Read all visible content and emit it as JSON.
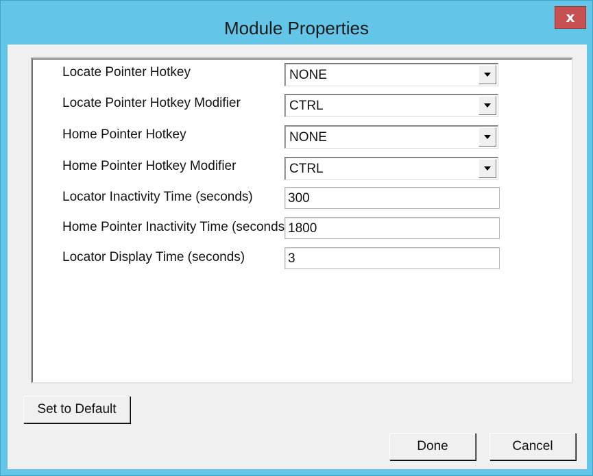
{
  "window": {
    "title": "Module Properties",
    "close_label": "x"
  },
  "fields": [
    {
      "label": "Locate Pointer Hotkey",
      "type": "dropdown",
      "value": "NONE"
    },
    {
      "label": "Locate Pointer Hotkey Modifier",
      "type": "dropdown",
      "value": "CTRL"
    },
    {
      "label": "Home Pointer Hotkey",
      "type": "dropdown",
      "value": "NONE"
    },
    {
      "label": "Home Pointer Hotkey Modifier",
      "type": "dropdown",
      "value": "CTRL"
    },
    {
      "label": "Locator Inactivity Time (seconds)",
      "type": "text",
      "value": "300"
    },
    {
      "label": "Home Pointer Inactivity Time (seconds)",
      "type": "text",
      "value": "1800"
    },
    {
      "label": "Locator Display Time (seconds)",
      "type": "text",
      "value": "3"
    }
  ],
  "buttons": {
    "set_default": "Set to Default",
    "done": "Done",
    "cancel": "Cancel"
  },
  "colors": {
    "title_bar": "#63c6e8",
    "close_button": "#c75050",
    "dialog_background": "#f0f0f0"
  },
  "icons": {
    "close": "close-icon",
    "dropdown": "chevron-down-icon"
  }
}
